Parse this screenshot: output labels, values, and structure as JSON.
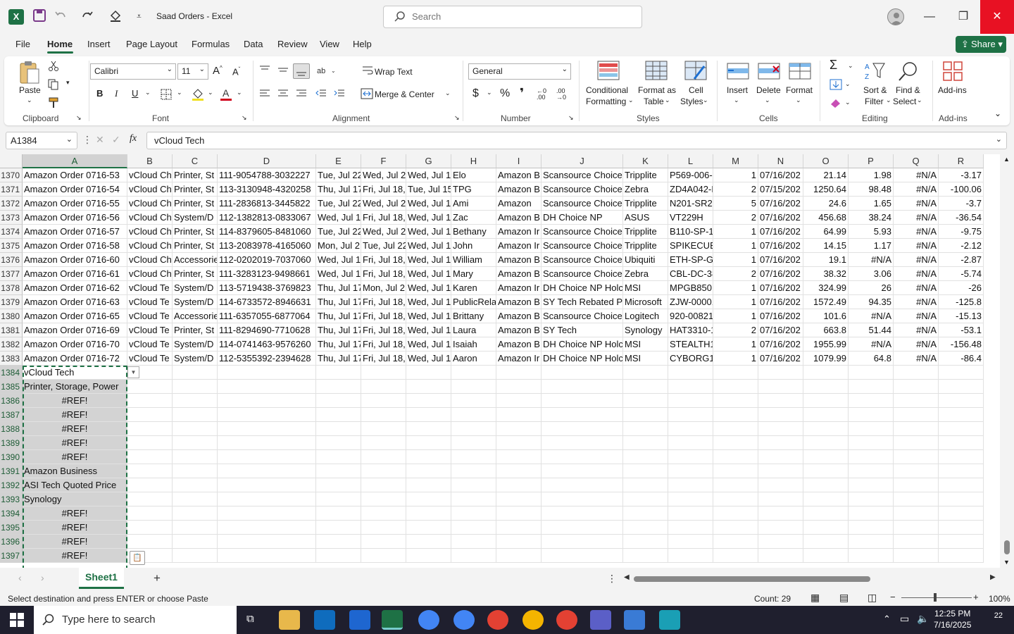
{
  "window": {
    "title": "Saad Orders  -  Excel",
    "search_placeholder": "Search"
  },
  "menu": {
    "tabs": [
      "File",
      "Home",
      "Insert",
      "Page Layout",
      "Formulas",
      "Data",
      "Review",
      "View",
      "Help"
    ],
    "share_label": "Share"
  },
  "ribbon": {
    "clipboard": {
      "paste": "Paste",
      "group": "Clipboard"
    },
    "font": {
      "name": "Calibri",
      "size": "11",
      "group": "Font"
    },
    "alignment": {
      "wrap_text": "Wrap Text",
      "merge_center": "Merge & Center",
      "group": "Alignment"
    },
    "number": {
      "format": "General",
      "group": "Number"
    },
    "styles": {
      "conditional": "Conditional",
      "conditional2": "Formatting",
      "format_as": "Format as",
      "format_as2": "Table",
      "cell_styles": "Cell",
      "cell_styles2": "Styles",
      "group": "Styles"
    },
    "cells": {
      "insert": "Insert",
      "delete": "Delete",
      "format": "Format",
      "group": "Cells"
    },
    "editing": {
      "sort": "Sort &",
      "sort2": "Filter",
      "find": "Find &",
      "find2": "Select",
      "group": "Editing"
    },
    "addins": {
      "label": "Add-ins",
      "group": "Add-ins"
    }
  },
  "formula_bar": {
    "name_box": "A1384",
    "fx": "fx",
    "content": "vCloud Tech"
  },
  "columns": [
    "A",
    "B",
    "C",
    "D",
    "E",
    "F",
    "G",
    "H",
    "I",
    "J",
    "K",
    "L",
    "M",
    "N",
    "O",
    "P",
    "Q",
    "R"
  ],
  "rows": [
    {
      "n": "1370",
      "c": [
        "Amazon Order 0716-53",
        "vCloud Ch",
        "Printer, St",
        "111-9054788-3032227",
        "Tue, Jul 22",
        "Wed, Jul 2",
        "Wed, Jul 1",
        "Elo",
        "Amazon B",
        "Scansource Choice",
        "Tripplite",
        "P569-006-",
        "1",
        "07/16/202",
        "21.14",
        "1.98",
        "#N/A",
        "-3.17"
      ]
    },
    {
      "n": "1371",
      "c": [
        "Amazon Order 0716-54",
        "vCloud Ch",
        "Printer, St",
        "113-3130948-4320258",
        "Thu, Jul 17",
        "Fri, Jul 18,",
        "Tue, Jul 15",
        "TPG",
        "Amazon B",
        "Scansource Choice",
        "Zebra",
        "ZD4A042-I",
        "2",
        "07/15/202",
        "1250.64",
        "98.48",
        "#N/A",
        "-100.06"
      ]
    },
    {
      "n": "1372",
      "c": [
        "Amazon Order 0716-55",
        "vCloud Ch",
        "Printer, St",
        "111-2836813-3445822",
        "Tue, Jul 22",
        "Wed, Jul 2",
        "Wed, Jul 1",
        "Ami",
        "Amazon",
        "Scansource Choice",
        "Tripplite",
        "N201-SR2-",
        "5",
        "07/16/202",
        "24.6",
        "1.65",
        "#N/A",
        "-3.7"
      ]
    },
    {
      "n": "1373",
      "c": [
        "Amazon Order 0716-56",
        "vCloud Ch",
        "System/D",
        "112-1382813-0833067",
        "Wed, Jul 1",
        "Fri, Jul 18,",
        "Wed, Jul 1",
        "Zac",
        "Amazon B",
        "DH Choice NP",
        "ASUS",
        "VT229H",
        "2",
        "07/16/202",
        "456.68",
        "38.24",
        "#N/A",
        "-36.54"
      ]
    },
    {
      "n": "1374",
      "c": [
        "Amazon Order 0716-57",
        "vCloud Ch",
        "Printer, St",
        "114-8379605-8481060",
        "Tue, Jul 22",
        "Wed, Jul 2",
        "Wed, Jul 1",
        "Bethany",
        "Amazon Ir",
        "Scansource Choice",
        "Tripplite",
        "B110-SP-1",
        "1",
        "07/16/202",
        "64.99",
        "5.93",
        "#N/A",
        "-9.75"
      ]
    },
    {
      "n": "1375",
      "c": [
        "Amazon Order 0716-58",
        "vCloud Ch",
        "Printer, St",
        "113-2083978-4165060",
        "Mon, Jul 2",
        "Tue, Jul 22",
        "Wed, Jul 1",
        "John",
        "Amazon Ir",
        "Scansource Choice",
        "Tripplite",
        "SPIKECUBI",
        "1",
        "07/16/202",
        "14.15",
        "1.17",
        "#N/A",
        "-2.12"
      ]
    },
    {
      "n": "1376",
      "c": [
        "Amazon Order 0716-60",
        "vCloud Ch",
        "Accessorie",
        "112-0202019-7037060",
        "Wed, Jul 1",
        "Fri, Jul 18,",
        "Wed, Jul 1",
        "William",
        "Amazon B",
        "Scansource Choice",
        "Ubiquiti",
        "ETH-SP-G2",
        "1",
        "07/16/202",
        "19.1",
        "#N/A",
        "#N/A",
        "-2.87"
      ]
    },
    {
      "n": "1377",
      "c": [
        "Amazon Order 0716-61",
        "vCloud Ch",
        "Printer, St",
        "111-3283123-9498661",
        "Wed, Jul 1",
        "Fri, Jul 18,",
        "Wed, Jul 1",
        "Mary",
        "Amazon B",
        "Scansource Choice",
        "Zebra",
        "CBL-DC-38",
        "2",
        "07/16/202",
        "38.32",
        "3.06",
        "#N/A",
        "-5.74"
      ]
    },
    {
      "n": "1378",
      "c": [
        "Amazon Order 0716-62",
        "vCloud Te",
        "System/D",
        "113-5719438-3769823",
        "Thu, Jul 17",
        "Mon, Jul 2",
        "Wed, Jul 1",
        "Karen",
        "Amazon Ir",
        "DH Choice NP Holc",
        "MSI",
        "MPGB850E",
        "1",
        "07/16/202",
        "324.99",
        "26",
        "#N/A",
        "-26"
      ]
    },
    {
      "n": "1379",
      "c": [
        "Amazon Order 0716-63",
        "vCloud Te",
        "System/D",
        "114-6733572-8946631",
        "Thu, Jul 17",
        "Fri, Jul 18,",
        "Wed, Jul 1",
        "PublicRela",
        "Amazon B",
        "SY Tech Rebated P",
        "Microsoft",
        "ZJW-00001",
        "1",
        "07/16/202",
        "1572.49",
        "94.35",
        "#N/A",
        "-125.8"
      ]
    },
    {
      "n": "1380",
      "c": [
        "Amazon Order 0716-65",
        "vCloud Te",
        "Accessorie",
        "111-6357055-6877064",
        "Thu, Jul 17",
        "Fri, Jul 18,",
        "Wed, Jul 1",
        "Brittany",
        "Amazon B",
        "Scansource Choice",
        "Logitech",
        "920-00821",
        "1",
        "07/16/202",
        "101.6",
        "#N/A",
        "#N/A",
        "-15.13"
      ]
    },
    {
      "n": "1381",
      "c": [
        "Amazon Order 0716-69",
        "vCloud Te",
        "Printer, St",
        "111-8294690-7710628",
        "Thu, Jul 17",
        "Fri, Jul 18,",
        "Wed, Jul 1",
        "Laura",
        "Amazon B",
        "SY Tech",
        "Synology",
        "HAT3310-1",
        "2",
        "07/16/202",
        "663.8",
        "51.44",
        "#N/A",
        "-53.1"
      ]
    },
    {
      "n": "1382",
      "c": [
        "Amazon Order 0716-70",
        "vCloud Te",
        "System/D",
        "114-0741463-9576260",
        "Thu, Jul 17",
        "Fri, Jul 18,",
        "Wed, Jul 1",
        "Isaiah",
        "Amazon B",
        "DH Choice NP Holc",
        "MSI",
        "STEALTH14",
        "1",
        "07/16/202",
        "1955.99",
        "#N/A",
        "#N/A",
        "-156.48"
      ]
    },
    {
      "n": "1383",
      "c": [
        "Amazon Order 0716-72",
        "vCloud Te",
        "System/D",
        "112-5355392-2394628",
        "Thu, Jul 17",
        "Fri, Jul 18,",
        "Wed, Jul 1",
        "Aaron",
        "Amazon Ir",
        "DH Choice NP Holc",
        "MSI",
        "CYBORG14",
        "1",
        "07/16/202",
        "1079.99",
        "64.8",
        "#N/A",
        "-86.4"
      ]
    }
  ],
  "pasted_rows": [
    {
      "n": "1384",
      "v": "vCloud Tech",
      "align": "left"
    },
    {
      "n": "1385",
      "v": "Printer, Storage, Power",
      "align": "left"
    },
    {
      "n": "1386",
      "v": "#REF!",
      "align": "center"
    },
    {
      "n": "1387",
      "v": "#REF!",
      "align": "center"
    },
    {
      "n": "1388",
      "v": "#REF!",
      "align": "center"
    },
    {
      "n": "1389",
      "v": "#REF!",
      "align": "center"
    },
    {
      "n": "1390",
      "v": "#REF!",
      "align": "center"
    },
    {
      "n": "1391",
      "v": "Amazon Business",
      "align": "left"
    },
    {
      "n": "1392",
      "v": "ASI Tech Quoted Price",
      "align": "left"
    },
    {
      "n": "1393",
      "v": "Synology",
      "align": "left"
    },
    {
      "n": "1394",
      "v": "#REF!",
      "align": "center"
    },
    {
      "n": "1395",
      "v": "#REF!",
      "align": "center"
    },
    {
      "n": "1396",
      "v": "#REF!",
      "align": "center"
    },
    {
      "n": "1397",
      "v": "#REF!",
      "align": "center"
    }
  ],
  "sheet_tabs": [
    "Sheet1"
  ],
  "status": {
    "message": "Select destination and press ENTER or choose Paste",
    "count": "Count: 29",
    "zoom": "100%"
  },
  "taskbar": {
    "search_placeholder": "Type here to search",
    "time": "12:25 PM",
    "date": "7/16/2025",
    "notifications": "22"
  },
  "colors": {
    "excel_green": "#1e7145",
    "close_red": "#e81123"
  }
}
